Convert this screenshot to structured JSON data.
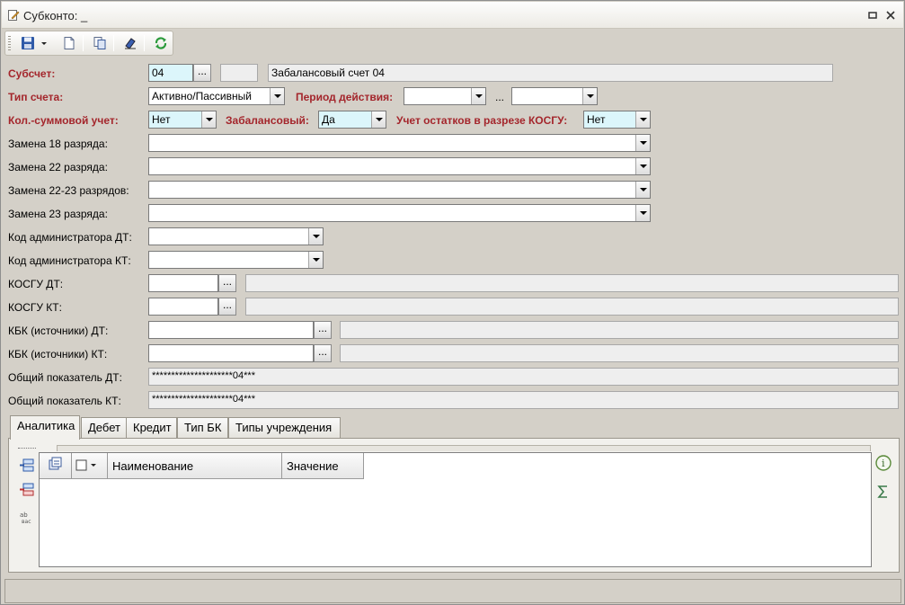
{
  "window": {
    "title": "Субконто: _"
  },
  "toolbar": {
    "save": "save-icon",
    "new": "new-document-icon",
    "copy": "copy-icon",
    "clear": "eraser-icon",
    "refresh": "refresh-icon"
  },
  "form": {
    "subaccount": {
      "label": "Субсчет:",
      "value": "04",
      "code": "",
      "name": "Забалансовый счет 04",
      "button": "..."
    },
    "account_type": {
      "label": "Тип счета:",
      "value": "Активно/Пассивный"
    },
    "period": {
      "label": "Период действия:",
      "from": "",
      "separator": "...",
      "to": ""
    },
    "qty_sum": {
      "label": "Кол.-суммовой учет:",
      "value": "Нет"
    },
    "off_balance": {
      "label": "Забалансовый:",
      "value": "Да"
    },
    "kosgu_balances": {
      "label": "Учет остатков в разрезе КОСГУ:",
      "value": "Нет"
    },
    "replace18": {
      "label": "Замена 18 разряда:",
      "value": ""
    },
    "replace22": {
      "label": "Замена 22 разряда:",
      "value": ""
    },
    "replace2223": {
      "label": "Замена 22-23 разрядов:",
      "value": ""
    },
    "replace23": {
      "label": "Замена 23 разряда:",
      "value": ""
    },
    "admin_dt": {
      "label": "Код администратора ДТ:",
      "value": ""
    },
    "admin_kt": {
      "label": "Код администратора КТ:",
      "value": ""
    },
    "kosgu_dt": {
      "label": "КОСГУ ДТ:",
      "value": "",
      "name": "",
      "button": "..."
    },
    "kosgu_kt": {
      "label": "КОСГУ КТ:",
      "value": "",
      "name": "",
      "button": "..."
    },
    "kbk_dt": {
      "label": "КБК (источники) ДТ:",
      "value": "",
      "name": "",
      "button": "..."
    },
    "kbk_kt": {
      "label": "КБК (источники) КТ:",
      "value": "",
      "name": "",
      "button": "..."
    },
    "total_dt": {
      "label": "Общий показатель ДТ:",
      "value": "*********************04***"
    },
    "total_kt": {
      "label": "Общий показатель КТ:",
      "value": "*********************04***"
    }
  },
  "tabs": [
    "Аналитика",
    "Дебет",
    "Кредит",
    "Тип БК",
    "Типы учреждения"
  ],
  "grid": {
    "columns": [
      "Наименование",
      "Значение"
    ]
  },
  "icons": {
    "add_row": "add-row-icon",
    "delete_row": "delete-row-icon",
    "abc": "spellcheck-icon",
    "info": "info-icon",
    "sum": "sum-icon"
  }
}
